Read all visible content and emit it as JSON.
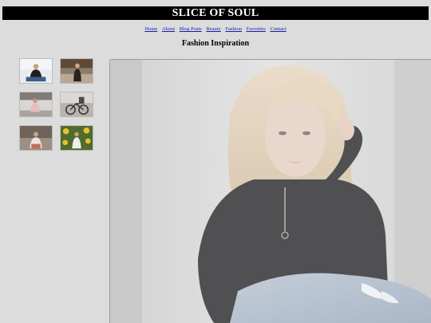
{
  "site": {
    "title": "SLICE OF SOUL"
  },
  "nav": {
    "items": [
      {
        "label": "Home"
      },
      {
        "label": "About"
      },
      {
        "label": "Blog Posts"
      },
      {
        "label": "Beauty"
      },
      {
        "label": "Fashion"
      },
      {
        "label": "Favorites"
      },
      {
        "label": "Contact"
      }
    ]
  },
  "main": {
    "heading": "Fashion Inspiration"
  },
  "gallery": {
    "thumbnails": [
      {
        "subject": "woman in black jacket sitting"
      },
      {
        "subject": "person in dark outfit near fence"
      },
      {
        "subject": "woman in pink dress"
      },
      {
        "subject": "bicycle scene"
      },
      {
        "subject": "seated woman in light outfit"
      },
      {
        "subject": "woman among sunflowers"
      }
    ],
    "featured": {
      "subject": "blonde woman in black half-zip sweater and ripped jeans"
    }
  },
  "colors": {
    "background": "#dcdcdc",
    "title_bar": "#000000",
    "title_text": "#ffffff",
    "link": "#1a1aa6"
  }
}
